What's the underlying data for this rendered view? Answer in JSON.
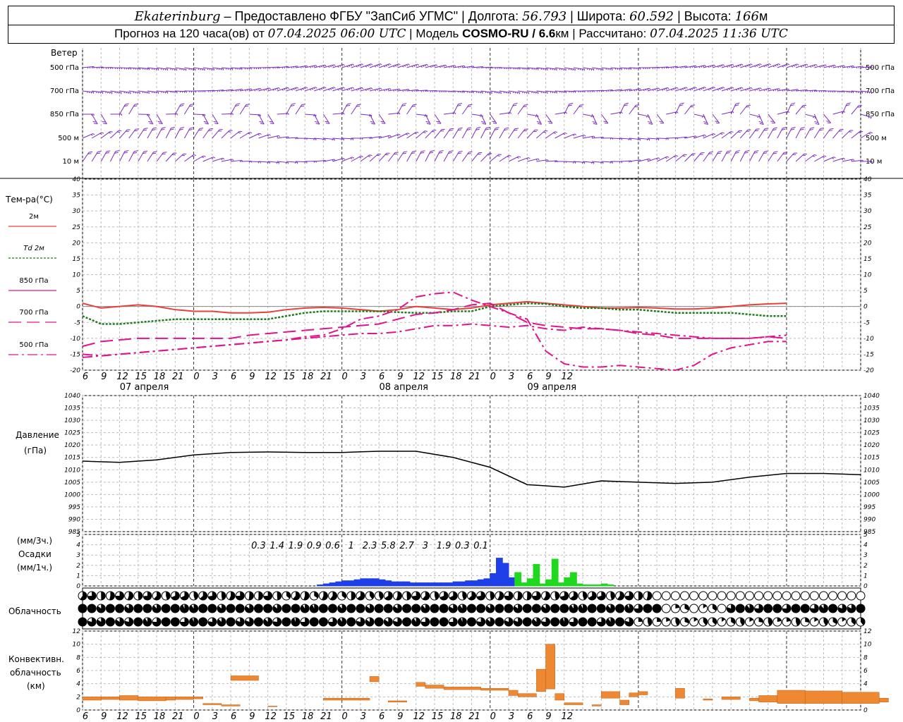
{
  "header": {
    "line1": {
      "city": "Ekaterinburg",
      "provider": "– Предоставлено ФГБУ \"ЗапСиб УГМС\"",
      "lon_label": "Долгота:",
      "lon": "56.793",
      "lat_label": "Широта:",
      "lat": "60.592",
      "alt_label": "Высота:",
      "alt": "166",
      "alt_unit": "м"
    },
    "line2": {
      "forecast": "Прогноз на 120 часа(ов) от",
      "issued": "07.04.2025 06:00 UTC",
      "model_label": "Модель",
      "model": "COSMO-RU / 6.6",
      "model_unit": "км",
      "calc_label": "Рассчитано:",
      "calc": "07.04.2025 11:36 UTC"
    }
  },
  "time_ticks": [
    "6",
    "9",
    "12",
    "15",
    "18",
    "21",
    "0",
    "3",
    "6",
    "9",
    "12",
    "15",
    "18",
    "21",
    "0",
    "3",
    "6",
    "9",
    "12",
    "15",
    "18",
    "21",
    "0",
    "3",
    "6",
    "9",
    "12"
  ],
  "dates": [
    "07 апреля",
    "08 апреля",
    "09 апреля"
  ],
  "wind": {
    "title": "Ветер",
    "levels": [
      "500 гПа",
      "700 гПа",
      "850 гПа",
      "500 м",
      "10 м"
    ],
    "color": "#7b2cbf"
  },
  "temperature": {
    "title": "Тем-ра(°C)",
    "legend": [
      {
        "label": "2м",
        "color": "#e8413b",
        "dash": "solid"
      },
      {
        "label": "Td 2м",
        "color": "#1f7a1f",
        "dash": "dotted"
      },
      {
        "label": "850 гПа",
        "color": "#e0148c",
        "dash": "solid"
      },
      {
        "label": "700 гПа",
        "color": "#e0148c",
        "dash": "long"
      },
      {
        "label": "500 гПа",
        "color": "#e0148c",
        "dash": "dashdot"
      }
    ]
  },
  "pressure": {
    "title": "Давление",
    "unit": "(гПа)"
  },
  "precip": {
    "title1": "(мм/3ч.)",
    "title2": "Осадки",
    "title3": "(мм/1ч.)",
    "totals": [
      "0.3",
      "1.4",
      "1.9",
      "0.9",
      "0.6",
      "1",
      "2.3",
      "5.8",
      "2.7",
      "3",
      "1.9",
      "0.3",
      "0.1"
    ]
  },
  "cloud": {
    "title": "Облачность"
  },
  "convective": {
    "title1": "Конвективн.",
    "title2": "облачность",
    "title3": "(км)"
  },
  "chart_data": [
    {
      "type": "line",
      "title": "Тем-ра(°C)",
      "x_hours": [
        0,
        3,
        6,
        9,
        12,
        15,
        18,
        21,
        24,
        27,
        30,
        33,
        36,
        39,
        42,
        45,
        48,
        51,
        54,
        57,
        60,
        63,
        66,
        69,
        72,
        75,
        78,
        81,
        84,
        87,
        90,
        93,
        96,
        99,
        102,
        105,
        108,
        111,
        114,
        117,
        120,
        123,
        126
      ],
      "ylim": [
        -20,
        40
      ],
      "series": [
        {
          "name": "2м",
          "values": [
            1,
            -0.5,
            0,
            0.5,
            0,
            -1,
            -1.5,
            -1.5,
            -2,
            -2,
            -1.8,
            -1,
            -0.5,
            -0.3,
            -0.5,
            -1,
            -1.5,
            -1,
            0,
            -0.5,
            -1,
            -0.5,
            0.5,
            1,
            1.5,
            1,
            0.5,
            0,
            -0.5,
            -0.5,
            -0.3,
            -0.5,
            -0.8,
            -0.8,
            -0.5,
            0,
            0.5,
            0.8,
            1
          ]
        },
        {
          "name": "Td 2м",
          "values": [
            -3,
            -5.5,
            -5.5,
            -5,
            -4.5,
            -4,
            -4,
            -4,
            -4,
            -4,
            -4,
            -3,
            -2,
            -1.5,
            -1.5,
            -1.5,
            -1.5,
            -1.8,
            -2,
            -2,
            -1.5,
            -1.5,
            0,
            0.5,
            1,
            0.8,
            0,
            -0.5,
            -0.5,
            -1,
            -1,
            -1.5,
            -2,
            -2,
            -2,
            -2,
            -2.5,
            -3,
            -3
          ]
        },
        {
          "name": "850 гПа",
          "values": [
            -15,
            -15.5,
            -15,
            -14.5,
            -14,
            -13.5,
            -13,
            -12.5,
            -12,
            -11.5,
            -11,
            -10.5,
            -9.5,
            -9,
            -7,
            -4,
            -3,
            -1,
            3,
            4,
            4.5,
            2,
            0,
            -2,
            -4,
            -14,
            -18,
            -19,
            -19,
            -18.5,
            -19,
            -19.5,
            -20,
            -18.5,
            -15,
            -13,
            -12,
            -11,
            -11
          ]
        },
        {
          "name": "700 гПа",
          "values": [
            -12.5,
            -11,
            -10.5,
            -10,
            -10,
            -10,
            -10,
            -10,
            -10,
            -9,
            -8.5,
            -8,
            -7.5,
            -7,
            -6.5,
            -6,
            -5.5,
            -4,
            -2.5,
            -2,
            -1,
            0.5,
            1,
            -2,
            -5,
            -6,
            -6.5,
            -7,
            -7,
            -7.5,
            -8.5,
            -9,
            -10,
            -10,
            -10,
            -10,
            -10,
            -9.5,
            -10
          ]
        },
        {
          "name": "500 гПа",
          "values": [
            -16,
            -15.5,
            -15,
            -14.5,
            -14,
            -13.5,
            -13,
            -12.5,
            -12,
            -11.5,
            -11,
            -10.5,
            -10,
            -9.5,
            -9,
            -8.5,
            -8.5,
            -8,
            -7,
            -6,
            -6,
            -5.5,
            -6,
            -6.5,
            -6,
            -7,
            -7.5,
            -6.5,
            -7,
            -7.5,
            -8,
            -8.5,
            -9,
            -9.5,
            -10,
            -10,
            -10,
            -9.5,
            -9
          ]
        }
      ]
    },
    {
      "type": "line",
      "title": "Давление",
      "ylabel": "(гПа)",
      "ylim": [
        985,
        1040
      ],
      "x_hours": [
        0,
        6,
        12,
        18,
        24,
        30,
        36,
        42,
        48,
        54,
        60,
        66,
        72,
        78,
        84,
        90,
        96,
        102,
        108,
        114,
        120,
        126
      ],
      "series": [
        {
          "name": "Давление",
          "values": [
            1013.5,
            1013,
            1014,
            1016,
            1017,
            1017.2,
            1017,
            1017,
            1017.5,
            1017.5,
            1015,
            1011,
            1004,
            1003,
            1005.5,
            1005,
            1004.5,
            1005,
            1007,
            1008.5,
            1008.5,
            1008
          ]
        }
      ]
    },
    {
      "type": "bar",
      "title": "Осадки",
      "ylim": [
        0,
        5
      ],
      "series": [
        {
          "name": "blue",
          "color": "#1f3fe8",
          "x_hours": [
            38,
            39,
            40,
            41,
            42,
            43,
            44,
            45,
            46,
            47,
            48,
            49,
            50,
            51,
            52,
            53,
            54,
            55,
            56,
            57,
            58,
            59,
            60,
            61,
            62,
            63,
            64,
            65,
            66,
            67,
            68,
            69,
            70,
            71,
            72,
            73,
            74,
            75
          ],
          "values": [
            0.1,
            0.2,
            0.3,
            0.4,
            0.5,
            0.5,
            0.6,
            0.7,
            0.7,
            0.7,
            0.6,
            0.5,
            0.4,
            0.4,
            0.4,
            0.3,
            0.3,
            0.3,
            0.3,
            0.3,
            0.3,
            0.3,
            0.4,
            0.4,
            0.5,
            0.5,
            0.6,
            0.7,
            1.2,
            2.7,
            2.2,
            0.8,
            0.1,
            0.1,
            0,
            0,
            0,
            0
          ]
        },
        {
          "name": "green",
          "color": "#1fd81f",
          "x_hours": [
            70,
            71,
            72,
            73,
            74,
            75,
            76,
            77,
            78,
            79,
            80,
            81,
            82,
            83,
            84,
            85,
            86
          ],
          "values": [
            1.3,
            0.3,
            0.7,
            2.1,
            0.2,
            0.6,
            2.6,
            0.3,
            0.8,
            1.3,
            0.2,
            0.1,
            0.1,
            0.1,
            0.2,
            0.1,
            0
          ]
        }
      ]
    },
    {
      "type": "bar",
      "title": "Конвективн. облачность",
      "ylabel": "(км)",
      "ylim": [
        0,
        12
      ],
      "color": "#ee8833",
      "segments": [
        {
          "from": 0,
          "to": 2,
          "bottom": 1.5,
          "top": 2
        },
        {
          "from": 2,
          "to": 4,
          "bottom": 1.6,
          "top": 2
        },
        {
          "from": 4,
          "to": 6,
          "bottom": 1.5,
          "top": 2.2
        },
        {
          "from": 6,
          "to": 9,
          "bottom": 1.4,
          "top": 2
        },
        {
          "from": 9,
          "to": 10,
          "bottom": 1.5,
          "top": 2
        },
        {
          "from": 10,
          "to": 12,
          "bottom": 1.6,
          "top": 2
        },
        {
          "from": 12,
          "to": 13,
          "bottom": 1.7,
          "top": 2
        },
        {
          "from": 13,
          "to": 15,
          "bottom": 0.8,
          "top": 1
        },
        {
          "from": 15,
          "to": 17,
          "bottom": 0.6,
          "top": 0.8
        },
        {
          "from": 16,
          "to": 19,
          "bottom": 4.5,
          "top": 5.2
        },
        {
          "from": 20,
          "to": 21,
          "bottom": 0.5,
          "top": 0.6
        },
        {
          "from": 26,
          "to": 31,
          "bottom": 1.5,
          "top": 1.8
        },
        {
          "from": 31,
          "to": 32,
          "bottom": 4.3,
          "top": 5.1
        },
        {
          "from": 33,
          "to": 35,
          "bottom": 1.2,
          "top": 1.4
        },
        {
          "from": 36,
          "to": 37,
          "bottom": 3.6,
          "top": 4.2
        },
        {
          "from": 37,
          "to": 39,
          "bottom": 3.3,
          "top": 3.8
        },
        {
          "from": 39,
          "to": 43,
          "bottom": 3.1,
          "top": 3.5
        },
        {
          "from": 43,
          "to": 46,
          "bottom": 3.0,
          "top": 3.3
        },
        {
          "from": 46,
          "to": 47,
          "bottom": 2.2,
          "top": 3
        },
        {
          "from": 47,
          "to": 49,
          "bottom": 2.0,
          "top": 2.5
        },
        {
          "from": 49,
          "to": 50,
          "bottom": 2.8,
          "top": 6.2
        },
        {
          "from": 50,
          "to": 51,
          "bottom": 3.2,
          "top": 10
        },
        {
          "from": 51,
          "to": 52,
          "bottom": 1.5,
          "top": 2.5
        },
        {
          "from": 52,
          "to": 54,
          "bottom": 0.8,
          "top": 1.1
        },
        {
          "from": 55,
          "to": 56,
          "bottom": 0.6,
          "top": 0.8
        },
        {
          "from": 56,
          "to": 58,
          "bottom": 1.8,
          "top": 2.8
        },
        {
          "from": 58,
          "to": 59,
          "bottom": 0.8,
          "top": 1.5
        },
        {
          "from": 59,
          "to": 60,
          "bottom": 2.0,
          "top": 2.6
        },
        {
          "from": 60,
          "to": 61,
          "bottom": 2.3,
          "top": 2.8
        },
        {
          "from": 64,
          "to": 65,
          "bottom": 1.8,
          "top": 3.3
        },
        {
          "from": 67,
          "to": 68,
          "bottom": 1.5,
          "top": 1.7
        },
        {
          "from": 69,
          "to": 71,
          "bottom": 1.6,
          "top": 2.0
        },
        {
          "from": 72,
          "to": 73,
          "bottom": 1.4,
          "top": 1.8
        },
        {
          "from": 73,
          "to": 75,
          "bottom": 1.2,
          "top": 2.2
        },
        {
          "from": 75,
          "to": 78,
          "bottom": 1.0,
          "top": 3.0
        },
        {
          "from": 78,
          "to": 82,
          "bottom": 1.0,
          "top": 2.9
        },
        {
          "from": 82,
          "to": 86,
          "bottom": 1.0,
          "top": 2.7
        },
        {
          "from": 86,
          "to": 87,
          "bottom": 1.2,
          "top": 1.8
        }
      ]
    }
  ]
}
